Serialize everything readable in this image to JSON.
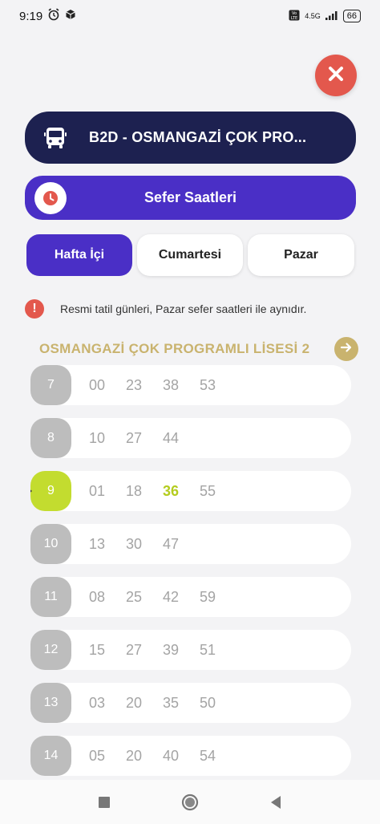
{
  "status_bar": {
    "time": "9:19",
    "network": "4.5G",
    "battery": "66"
  },
  "route": {
    "name": "B2D - OSMANGAZİ ÇOK PRO..."
  },
  "schedule_button": {
    "label": "Sefer Saatleri"
  },
  "tabs": [
    {
      "label": "Hafta İçi",
      "active": true
    },
    {
      "label": "Cumartesi",
      "active": false
    },
    {
      "label": "Pazar",
      "active": false
    }
  ],
  "notice": {
    "text": "Resmi tatil günleri, Pazar sefer saatleri ile aynıdır."
  },
  "stop": {
    "name": "OSMANGAZİ ÇOK PROGRAMLI LİSESİ 2"
  },
  "schedule": [
    {
      "hour": "7",
      "minutes": [
        "00",
        "23",
        "38",
        "53"
      ]
    },
    {
      "hour": "8",
      "minutes": [
        "10",
        "27",
        "44"
      ]
    },
    {
      "hour": "9",
      "minutes": [
        "01",
        "18",
        "36",
        "55"
      ],
      "current": true,
      "highlight": "36"
    },
    {
      "hour": "10",
      "minutes": [
        "13",
        "30",
        "47"
      ]
    },
    {
      "hour": "11",
      "minutes": [
        "08",
        "25",
        "42",
        "59"
      ]
    },
    {
      "hour": "12",
      "minutes": [
        "15",
        "27",
        "39",
        "51"
      ]
    },
    {
      "hour": "13",
      "minutes": [
        "03",
        "20",
        "35",
        "50"
      ]
    },
    {
      "hour": "14",
      "minutes": [
        "05",
        "20",
        "40",
        "54"
      ]
    }
  ],
  "colors": {
    "accent_purple": "#4a2fc6",
    "navy": "#1d2150",
    "close_red": "#e3584d",
    "gold": "#c9b36e",
    "lime": "#c3dc2f"
  },
  "icons": {
    "close": "close-icon",
    "bus": "bus-icon",
    "clock": "clock-icon",
    "warning": "warning-icon",
    "arrow": "arrow-right-icon"
  }
}
